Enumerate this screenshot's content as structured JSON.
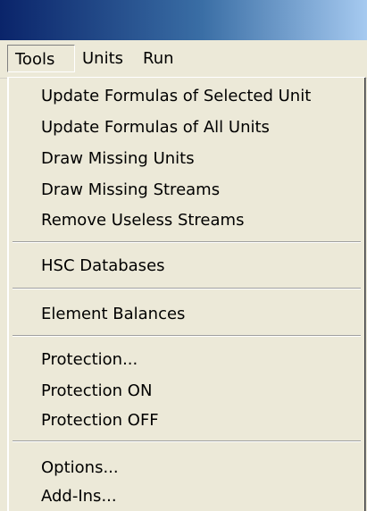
{
  "menubar": {
    "items": [
      {
        "label": "Tools"
      },
      {
        "label": "Units"
      },
      {
        "label": "Run"
      }
    ]
  },
  "dropdown": {
    "groups": [
      {
        "items": [
          {
            "label": "Update Formulas of Selected Unit"
          },
          {
            "label": "Update Formulas of All Units"
          },
          {
            "label": "Draw Missing Units"
          },
          {
            "label": "Draw Missing Streams"
          },
          {
            "label": "Remove Useless Streams"
          }
        ]
      },
      {
        "items": [
          {
            "label": "HSC Databases"
          }
        ]
      },
      {
        "items": [
          {
            "label": "Element Balances"
          }
        ]
      },
      {
        "items": [
          {
            "label": "Protection..."
          },
          {
            "label": "Protection ON"
          },
          {
            "label": "Protection OFF"
          }
        ]
      },
      {
        "items": [
          {
            "label": "Options..."
          },
          {
            "label": "Add-Ins..."
          }
        ]
      }
    ]
  },
  "colors": {
    "menu_background": "#ece9d8",
    "titlebar_dark": "#0a246a",
    "titlebar_light": "#a6caf0",
    "separator": "#a0a0a0"
  }
}
